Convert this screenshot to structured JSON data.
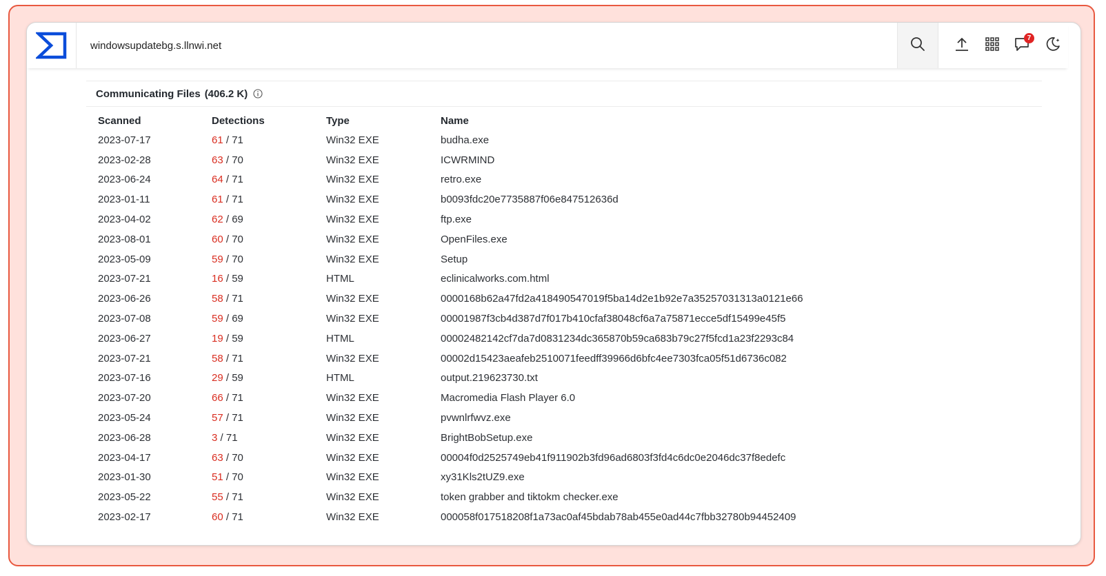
{
  "header": {
    "search_text": "windowsupdatebg.s.llnwi.net",
    "notification_count": "7"
  },
  "section": {
    "title": "Communicating Files",
    "count": "(406.2 K)"
  },
  "table": {
    "headers": {
      "scanned": "Scanned",
      "detections": "Detections",
      "type": "Type",
      "name": "Name"
    },
    "rows": [
      {
        "scanned": "2023-07-17",
        "positives": "61",
        "total": " / 71",
        "type": "Win32 EXE",
        "name": "budha.exe"
      },
      {
        "scanned": "2023-02-28",
        "positives": "63",
        "total": " / 70",
        "type": "Win32 EXE",
        "name": "ICWRMIND"
      },
      {
        "scanned": "2023-06-24",
        "positives": "64",
        "total": " / 71",
        "type": "Win32 EXE",
        "name": "retro.exe"
      },
      {
        "scanned": "2023-01-11",
        "positives": "61",
        "total": " / 71",
        "type": "Win32 EXE",
        "name": "b0093fdc20e7735887f06e847512636d"
      },
      {
        "scanned": "2023-04-02",
        "positives": "62",
        "total": " / 69",
        "type": "Win32 EXE",
        "name": "ftp.exe"
      },
      {
        "scanned": "2023-08-01",
        "positives": "60",
        "total": " / 70",
        "type": "Win32 EXE",
        "name": "OpenFiles.exe"
      },
      {
        "scanned": "2023-05-09",
        "positives": "59",
        "total": " / 70",
        "type": "Win32 EXE",
        "name": "Setup"
      },
      {
        "scanned": "2023-07-21",
        "positives": "16",
        "total": " / 59",
        "type": "HTML",
        "name": "eclinicalworks.com.html"
      },
      {
        "scanned": "2023-06-26",
        "positives": "58",
        "total": " / 71",
        "type": "Win32 EXE",
        "name": "0000168b62a47fd2a418490547019f5ba14d2e1b92e7a35257031313a0121e66"
      },
      {
        "scanned": "2023-07-08",
        "positives": "59",
        "total": " / 69",
        "type": "Win32 EXE",
        "name": "00001987f3cb4d387d7f017b410cfaf38048cf6a7a75871ecce5df15499e45f5"
      },
      {
        "scanned": "2023-06-27",
        "positives": "19",
        "total": " / 59",
        "type": "HTML",
        "name": "00002482142cf7da7d0831234dc365870b59ca683b79c27f5fcd1a23f2293c84"
      },
      {
        "scanned": "2023-07-21",
        "positives": "58",
        "total": " / 71",
        "type": "Win32 EXE",
        "name": "00002d15423aeafeb2510071feedff39966d6bfc4ee7303fca05f51d6736c082"
      },
      {
        "scanned": "2023-07-16",
        "positives": "29",
        "total": " / 59",
        "type": "HTML",
        "name": "output.219623730.txt"
      },
      {
        "scanned": "2023-07-20",
        "positives": "66",
        "total": " / 71",
        "type": "Win32 EXE",
        "name": "Macromedia Flash Player 6.0"
      },
      {
        "scanned": "2023-05-24",
        "positives": "57",
        "total": " / 71",
        "type": "Win32 EXE",
        "name": "pvwnlrfwvz.exe"
      },
      {
        "scanned": "2023-06-28",
        "positives": "3",
        "total": " / 71",
        "type": "Win32 EXE",
        "name": "BrightBobSetup.exe"
      },
      {
        "scanned": "2023-04-17",
        "positives": "63",
        "total": " / 70",
        "type": "Win32 EXE",
        "name": "00004f0d2525749eb41f911902b3fd96ad6803f3fd4c6dc0e2046dc37f8edefc"
      },
      {
        "scanned": "2023-01-30",
        "positives": "51",
        "total": " / 70",
        "type": "Win32 EXE",
        "name": "xy31Kls2tUZ9.exe"
      },
      {
        "scanned": "2023-05-22",
        "positives": "55",
        "total": " / 71",
        "type": "Win32 EXE",
        "name": "token grabber and tiktokm checker.exe"
      },
      {
        "scanned": "2023-02-17",
        "positives": "60",
        "total": " / 71",
        "type": "Win32 EXE",
        "name": "000058f017518208f1a73ac0af45bdab78ab455e0ad44c7fbb32780b94452409"
      }
    ]
  },
  "icons": [
    "sigma-logo-icon",
    "search-icon",
    "upload-icon",
    "grid-menu-icon",
    "notifications-icon",
    "dark-mode-moon-icon",
    "info-icon"
  ],
  "colors": {
    "brand_blue": "#0b4dda",
    "detection_red": "#d92d20",
    "frame_border": "#e8583f",
    "frame_fill": "#ffe1dc"
  }
}
